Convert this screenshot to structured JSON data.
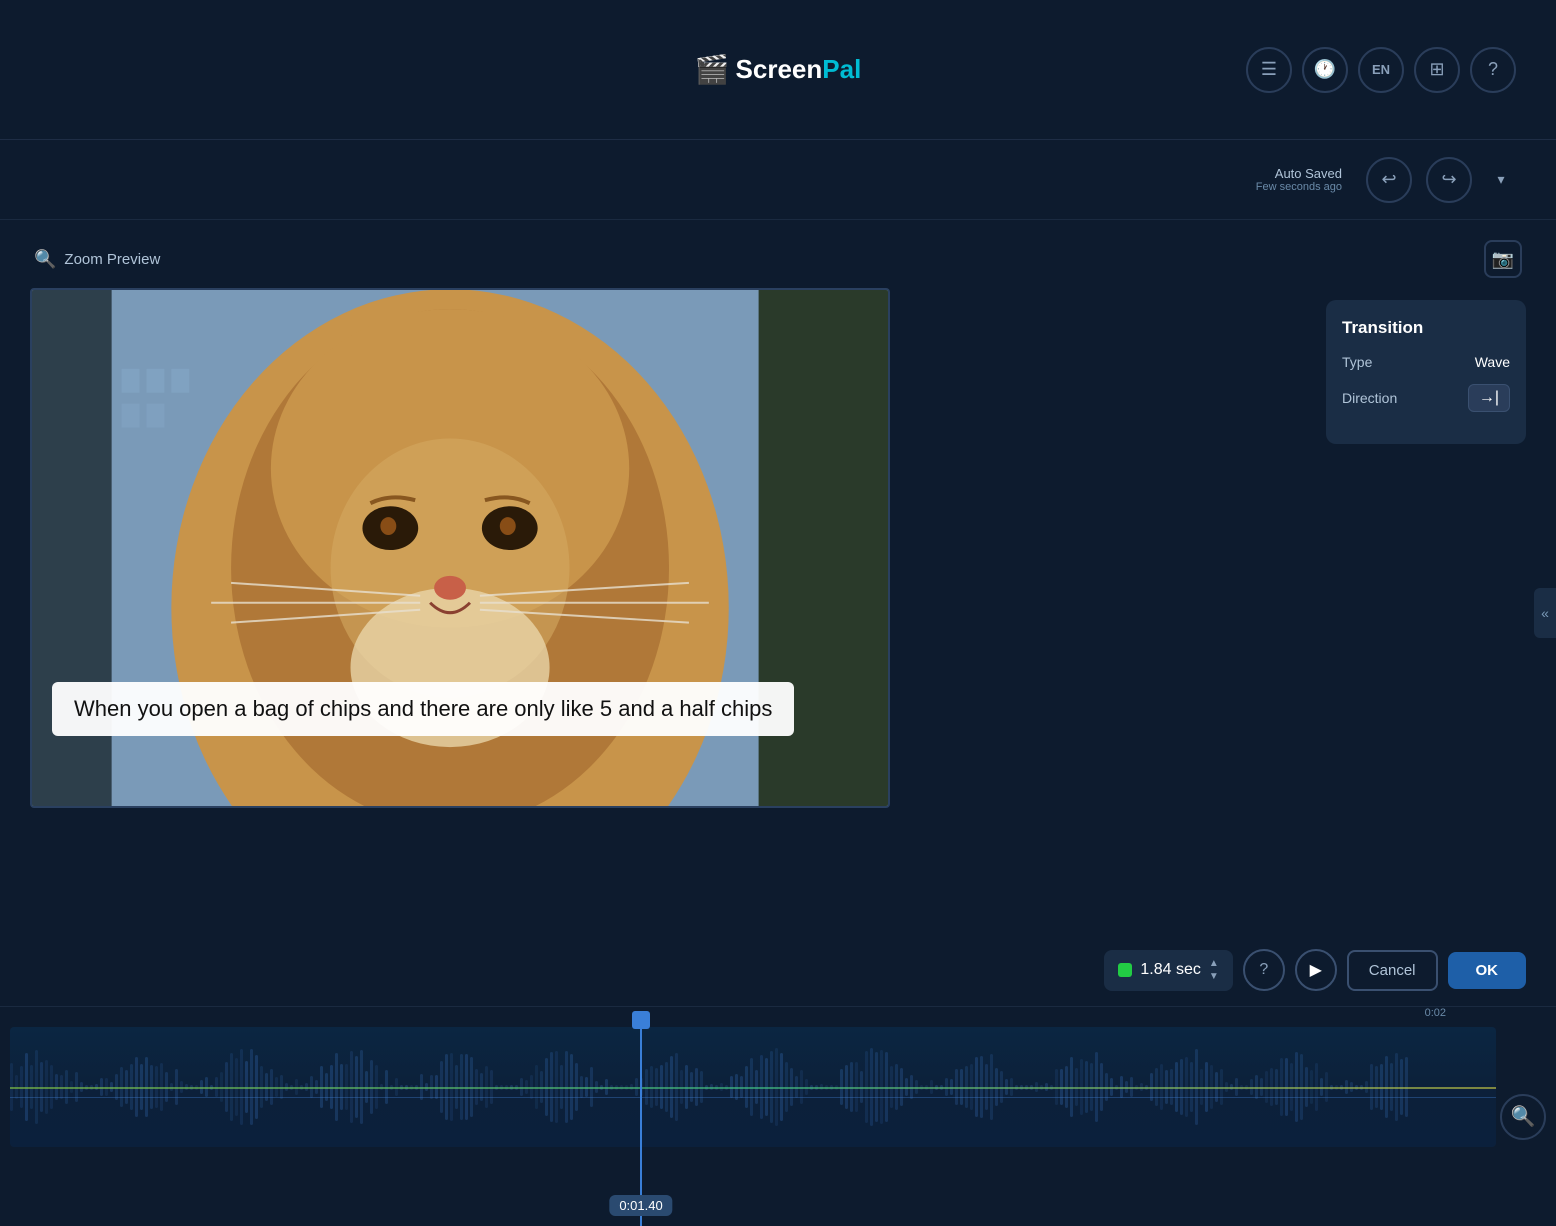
{
  "app": {
    "title": "ScreenPal",
    "logo_icon": "🎬"
  },
  "nav": {
    "icons": [
      {
        "name": "menu-icon",
        "symbol": "☰"
      },
      {
        "name": "history-icon",
        "symbol": "🕐"
      },
      {
        "name": "language-label",
        "symbol": "EN"
      },
      {
        "name": "layers-icon",
        "symbol": "⊞"
      },
      {
        "name": "help-icon",
        "symbol": "?"
      }
    ]
  },
  "toolbar": {
    "auto_saved_label": "Auto Saved",
    "auto_saved_time": "Few seconds ago",
    "undo_label": "↩",
    "redo_label": "↪",
    "dropdown_label": "▾"
  },
  "preview": {
    "zoom_label": "Zoom Preview",
    "camera_icon": "📷"
  },
  "caption": {
    "text": "When you open a bag of chips and there are only like 5 and a half chips"
  },
  "transition": {
    "title": "Transition",
    "type_label": "Type",
    "type_value": "Wave",
    "direction_label": "Direction",
    "direction_value": "→|"
  },
  "playback": {
    "duration": "1.84 sec",
    "help_icon": "?",
    "play_icon": "▶",
    "cancel_label": "Cancel",
    "ok_label": "OK"
  },
  "timeline": {
    "current_time": "0:01.40",
    "ruler_mark": "0:02",
    "search_icon": "🔍"
  }
}
